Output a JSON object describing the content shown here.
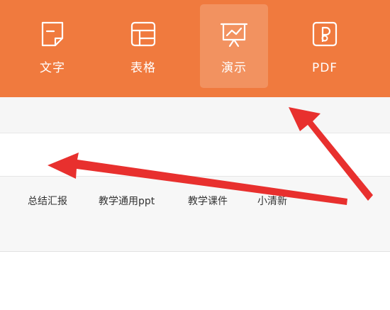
{
  "tabs": [
    {
      "label": "文字",
      "icon": "document-icon"
    },
    {
      "label": "表格",
      "icon": "table-icon"
    },
    {
      "label": "演示",
      "icon": "presentation-icon",
      "active": true
    },
    {
      "label": "PDF",
      "icon": "pdf-icon"
    }
  ],
  "tags": [
    "总结汇报",
    "教学通用ppt",
    "教学课件",
    "小清新"
  ],
  "colors": {
    "accent": "#f07a3e",
    "arrow": "#e8302e"
  }
}
